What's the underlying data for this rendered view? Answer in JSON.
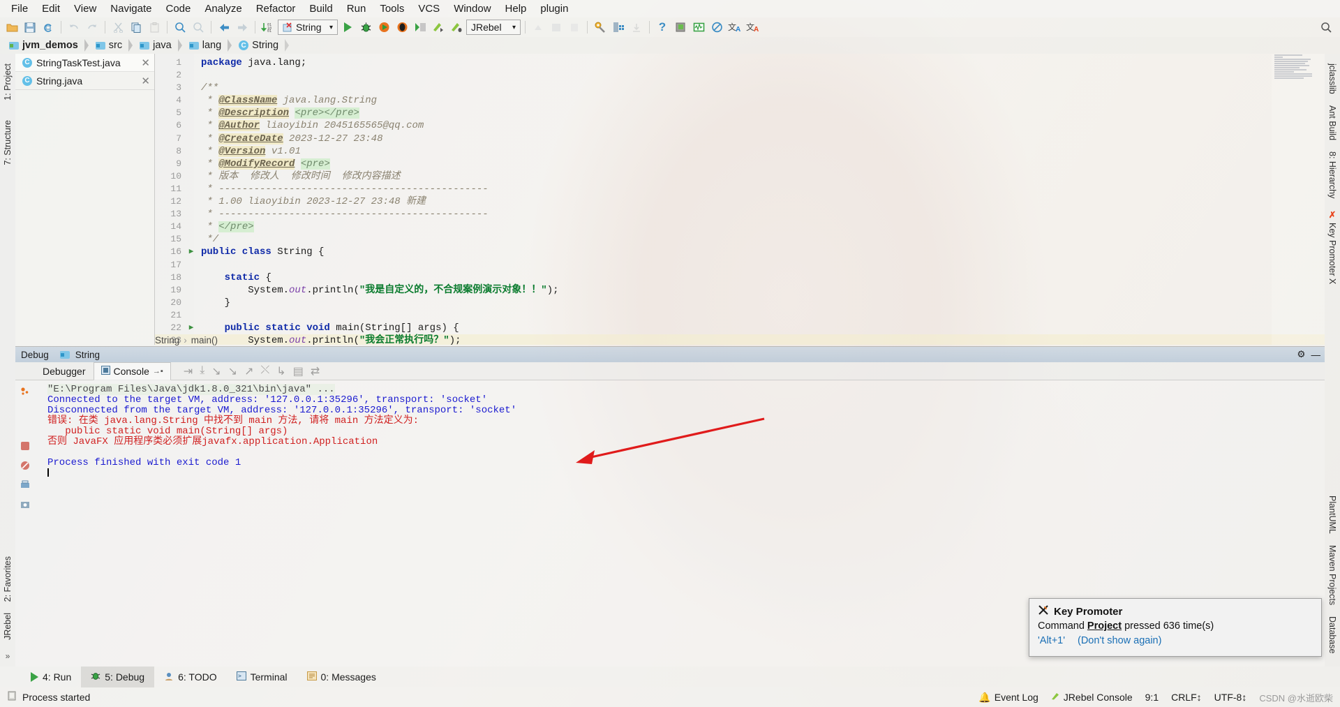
{
  "menubar": [
    {
      "label": "File"
    },
    {
      "label": "Edit"
    },
    {
      "label": "View"
    },
    {
      "label": "Navigate"
    },
    {
      "label": "Code"
    },
    {
      "label": "Analyze"
    },
    {
      "label": "Refactor"
    },
    {
      "label": "Build"
    },
    {
      "label": "Run"
    },
    {
      "label": "Tools"
    },
    {
      "label": "VCS"
    },
    {
      "label": "Window"
    },
    {
      "label": "Help"
    },
    {
      "label": "plugin"
    }
  ],
  "toolbar": {
    "run_config": "String",
    "run_config_icon": "class-error-icon",
    "jrebel": "JRebel",
    "icons": [
      "open-folder-icon",
      "save-all-icon",
      "sync-refresh-icon",
      "undo-icon",
      "redo-icon",
      "cut-icon",
      "copy-icon",
      "paste-icon",
      "find-icon",
      "replace-icon",
      "back-icon",
      "forward-icon",
      "compile-icon",
      "run-icon",
      "debug-icon",
      "run-coverage-icon",
      "profile-icon",
      "run-anything-icon",
      "jrebel-run-icon",
      "jrebel-debug-icon",
      "update-project-icon",
      "commit-icon",
      "rollback-icon",
      "settings-icon",
      "project-structure-icon",
      "download-icon",
      "help-icon",
      "memory-save-icon",
      "monitor-icon",
      "no-entry-icon",
      "translate-blue-icon",
      "translate-red-icon"
    ]
  },
  "breadcrumb": [
    {
      "label": "jvm_demos",
      "icon": "project-folder-icon",
      "bold": true
    },
    {
      "label": "src",
      "icon": "source-folder-icon",
      "bold": false
    },
    {
      "label": "java",
      "icon": "folder-icon",
      "bold": false
    },
    {
      "label": "lang",
      "icon": "folder-icon",
      "bold": false
    },
    {
      "label": "String",
      "icon": "class-icon",
      "bold": false
    }
  ],
  "left_strip": [
    {
      "label": "1: Project"
    },
    {
      "label": "7: Structure"
    },
    {
      "label": "2: Favorites"
    },
    {
      "label": "JRebel"
    }
  ],
  "right_strip": [
    {
      "label": "jclasslib"
    },
    {
      "label": "Ant Build"
    },
    {
      "label": "8: Hierarchy"
    },
    {
      "label": "Key Promoter X"
    },
    {
      "label": "PlantUML"
    },
    {
      "label": "Maven Projects"
    },
    {
      "label": "Database"
    }
  ],
  "file_tabs": [
    {
      "label": "StringTaskTest.java",
      "active": false,
      "icon": "java-run-class-icon"
    },
    {
      "label": "String.java",
      "active": true,
      "icon": "java-class-icon"
    }
  ],
  "editor": {
    "bottom_breadcrumb": [
      "String",
      "main()"
    ],
    "lines": [
      {
        "n": "1",
        "fold": "",
        "hl": false,
        "html": "<span class=\"kw\">package</span> <span class=\"plain\">java.lang;</span>"
      },
      {
        "n": "2",
        "fold": "",
        "hl": false,
        "html": ""
      },
      {
        "n": "3",
        "fold": "",
        "hl": false,
        "html": "<span class=\"jd\">/**</span>"
      },
      {
        "n": "4",
        "fold": "",
        "hl": false,
        "html": "<span class=\"jd\"> * </span><span class=\"jdtag\">@ClassName</span><span class=\"jd\"> java.lang.String</span>"
      },
      {
        "n": "5",
        "fold": "",
        "hl": false,
        "html": "<span class=\"jd\"> * </span><span class=\"jdtag\">@Description</span><span class=\"jd\"> </span><span class=\"prehl\">&lt;pre&gt;&lt;/pre&gt;</span>"
      },
      {
        "n": "6",
        "fold": "",
        "hl": false,
        "html": "<span class=\"jd\"> * </span><span class=\"jdtag\">@Author</span><span class=\"jd\"> liaoyibin 2045165565@qq.com</span>"
      },
      {
        "n": "7",
        "fold": "",
        "hl": false,
        "html": "<span class=\"jd\"> * </span><span class=\"jdtag\">@CreateDate</span><span class=\"jd\"> 2023-12-27 23:48</span>"
      },
      {
        "n": "8",
        "fold": "",
        "hl": false,
        "html": "<span class=\"jd\"> * </span><span class=\"jdtag\">@Version</span><span class=\"jd\"> v1.01</span>"
      },
      {
        "n": "9",
        "fold": "",
        "hl": false,
        "html": "<span class=\"jd\"> * </span><span class=\"jdtag\">@ModifyRecord</span><span class=\"jd\"> </span><span class=\"prehl\">&lt;pre&gt;</span>"
      },
      {
        "n": "10",
        "fold": "",
        "hl": false,
        "html": "<span class=\"jd\"> * 版本  修改人  修改时间  修改内容描述</span>"
      },
      {
        "n": "11",
        "fold": "",
        "hl": false,
        "html": "<span class=\"jd\"> * ----------------------------------------------</span>"
      },
      {
        "n": "12",
        "fold": "",
        "hl": false,
        "html": "<span class=\"jd\"> * 1.00 liaoyibin 2023-12-27 23:48 新建</span>"
      },
      {
        "n": "13",
        "fold": "",
        "hl": false,
        "html": "<span class=\"jd\"> * ----------------------------------------------</span>"
      },
      {
        "n": "14",
        "fold": "",
        "hl": false,
        "html": "<span class=\"jd\"> * </span><span class=\"prehl\">&lt;/pre&gt;</span>"
      },
      {
        "n": "15",
        "fold": "",
        "hl": false,
        "html": "<span class=\"jd\"> */</span>"
      },
      {
        "n": "16",
        "fold": "▶",
        "hl": false,
        "html": "<span class=\"kw\">public class</span> <span class=\"plain\">String {</span>"
      },
      {
        "n": "17",
        "fold": "",
        "hl": false,
        "html": ""
      },
      {
        "n": "18",
        "fold": "",
        "hl": false,
        "html": "    <span class=\"kw\">static</span> <span class=\"plain\">{</span>"
      },
      {
        "n": "19",
        "fold": "",
        "hl": false,
        "html": "        <span class=\"plain\">System.</span><span class=\"fld\">out</span><span class=\"plain\">.println(</span><span class=\"strzh\">\"我是自定义的，不合规案例演示对象！！\"</span><span class=\"plain\">);</span>"
      },
      {
        "n": "20",
        "fold": "",
        "hl": false,
        "html": "    <span class=\"plain\">}</span>"
      },
      {
        "n": "21",
        "fold": "",
        "hl": false,
        "html": ""
      },
      {
        "n": "22",
        "fold": "▶",
        "hl": false,
        "html": "    <span class=\"kw\">public static void</span> <span class=\"plain\">main(String[] args) {</span>"
      },
      {
        "n": "23",
        "fold": "",
        "hl": true,
        "html": "        <span class=\"plain\">System.</span><span class=\"fld\">out</span><span class=\"plain\">.println(</span><span class=\"strzh\">\"我会正常执行吗？\"</span><span class=\"plain\">);</span>"
      }
    ]
  },
  "debug_window": {
    "title": "Debug",
    "config_name": "String",
    "tabs": [
      {
        "label": "Debugger",
        "active": false,
        "icon": "debugger-icon"
      },
      {
        "label": "Console",
        "active": true,
        "icon": "console-icon"
      }
    ],
    "console_lines": [
      {
        "cls": "c-cmd",
        "text": "\"E:\\Program Files\\Java\\jdk1.8.0_321\\bin\\java\" ..."
      },
      {
        "cls": "c-info",
        "text": "Connected to the target VM, address: '127.0.0.1:35296', transport: 'socket'"
      },
      {
        "cls": "c-info",
        "text": "Disconnected from the target VM, address: '127.0.0.1:35296', transport: 'socket'"
      },
      {
        "cls": "c-err",
        "text": "错误: 在类 java.lang.String 中找不到 main 方法, 请将 main 方法定义为:"
      },
      {
        "cls": "c-err",
        "text": "   public static void main(String[] args)"
      },
      {
        "cls": "c-err",
        "text": "否则 JavaFX 应用程序类必须扩展javafx.application.Application"
      },
      {
        "cls": "c-info",
        "text": ""
      },
      {
        "cls": "c-info",
        "text": "Process finished with exit code 1"
      }
    ]
  },
  "key_promoter": {
    "title": "Key Promoter",
    "message_prefix": "Command ",
    "message_bold": "Project",
    "message_suffix": " pressed 636 time(s)",
    "shortcut_link": "'Alt+1'",
    "dismiss_link": "(Don't show again)",
    "close_icon": "close-x-icon"
  },
  "bottom_tabs": [
    {
      "label": "4: Run",
      "active": false,
      "icon": "run-icon"
    },
    {
      "label": "5: Debug",
      "active": true,
      "icon": "debug-bug-icon"
    },
    {
      "label": "6: TODO",
      "active": false,
      "icon": "todo-icon"
    },
    {
      "label": "Terminal",
      "active": false,
      "icon": "terminal-icon"
    },
    {
      "label": "0: Messages",
      "active": false,
      "icon": "messages-icon"
    }
  ],
  "statusbar": {
    "message": "Process started",
    "event_log": "Event Log",
    "jrebel_console": "JRebel Console",
    "caret": "9:1",
    "line_sep": "CRLF↕",
    "encoding": "UTF-8↕",
    "watermark": "CSDN @水逝欧柴"
  },
  "colors": {
    "accent_blue": "#1a6fb5",
    "error_red": "#d02020",
    "console_info": "#1a1ad0",
    "string_green": "#0a7b2e",
    "keyword_blue": "#0f2aa8",
    "arrow_red": "#e01b1b"
  }
}
